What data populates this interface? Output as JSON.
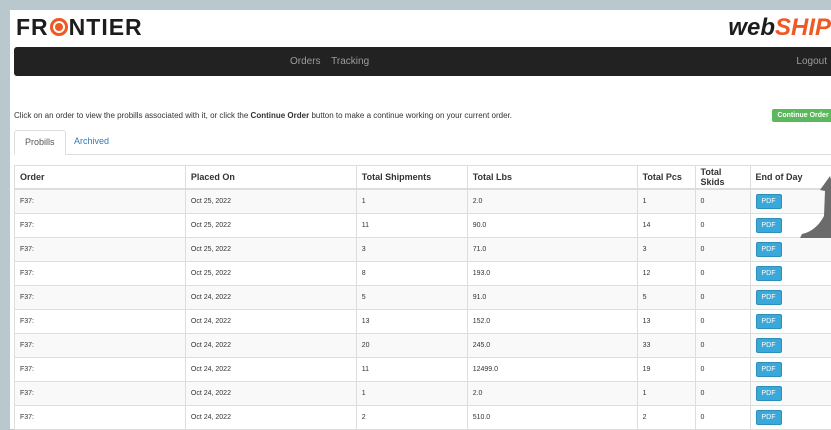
{
  "brand": {
    "logo_pre": "FR",
    "logo_post": "NTIER",
    "product_part1": "web",
    "product_part2": "SHIP"
  },
  "nav": {
    "items": [
      "Orders",
      "Tracking"
    ],
    "logout": "Logout"
  },
  "instructions": {
    "before": "Click on an order to view the probills associated with it, or click the ",
    "bold": "Continue Order",
    "after": " button to make a continue working on your current order."
  },
  "continue_button": "Continue Order",
  "tabs": {
    "active": "Probills",
    "other": "Archived"
  },
  "table": {
    "headers": [
      "Order",
      "Placed On",
      "Total Shipments",
      "Total Lbs",
      "Total Pcs",
      "Total Skids",
      "End of Day"
    ],
    "pdf_label": "PDF",
    "rows": [
      {
        "order": "F37:",
        "placed": "Oct 25, 2022",
        "shipments": "1",
        "lbs": "2.0",
        "pcs": "1",
        "skids": "0"
      },
      {
        "order": "F37:",
        "placed": "Oct 25, 2022",
        "shipments": "11",
        "lbs": "90.0",
        "pcs": "14",
        "skids": "0"
      },
      {
        "order": "F37:",
        "placed": "Oct 25, 2022",
        "shipments": "3",
        "lbs": "71.0",
        "pcs": "3",
        "skids": "0"
      },
      {
        "order": "F37:",
        "placed": "Oct 25, 2022",
        "shipments": "8",
        "lbs": "193.0",
        "pcs": "12",
        "skids": "0"
      },
      {
        "order": "F37:",
        "placed": "Oct 24, 2022",
        "shipments": "5",
        "lbs": "91.0",
        "pcs": "5",
        "skids": "0"
      },
      {
        "order": "F37:",
        "placed": "Oct 24, 2022",
        "shipments": "13",
        "lbs": "152.0",
        "pcs": "13",
        "skids": "0"
      },
      {
        "order": "F37:",
        "placed": "Oct 24, 2022",
        "shipments": "20",
        "lbs": "245.0",
        "pcs": "33",
        "skids": "0"
      },
      {
        "order": "F37:",
        "placed": "Oct 24, 2022",
        "shipments": "11",
        "lbs": "12499.0",
        "pcs": "19",
        "skids": "0"
      },
      {
        "order": "F37:",
        "placed": "Oct 24, 2022",
        "shipments": "1",
        "lbs": "2.0",
        "pcs": "1",
        "skids": "0"
      },
      {
        "order": "F37:",
        "placed": "Oct 24, 2022",
        "shipments": "2",
        "lbs": "510.0",
        "pcs": "2",
        "skids": "0"
      }
    ]
  },
  "colors": {
    "navbar": "#222222",
    "brand_accent": "#ee5a24",
    "continue_green": "#5cb85c",
    "pdf_blue": "#3aa8d8",
    "link_blue": "#337ab7",
    "arrow_gray": "#6b6b6b"
  },
  "annotation": {
    "icon": "pointer-arrow-icon"
  }
}
